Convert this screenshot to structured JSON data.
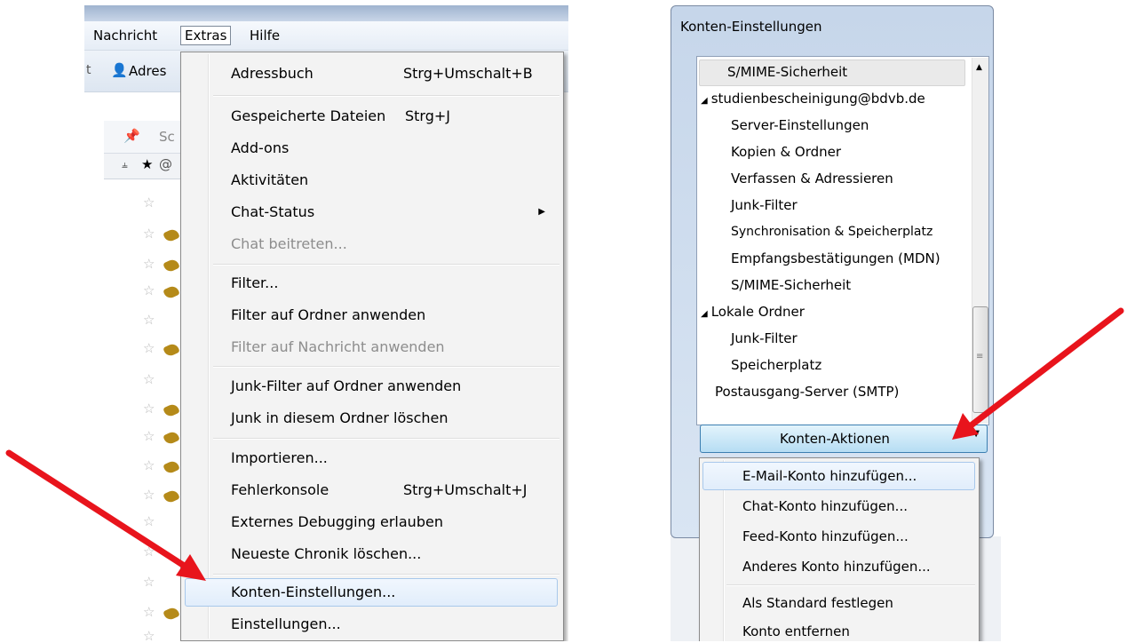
{
  "left": {
    "menubar": [
      "Nachricht",
      "Extras",
      "Hilfe"
    ],
    "toolbar_label": "Adres",
    "search_partial": "Sc",
    "menu": [
      {
        "label": "Adressbuch",
        "shortcut": "Strg+Umschalt+B"
      },
      {
        "label": "Gespeicherte Dateien",
        "shortcut": "Strg+J"
      },
      {
        "label": "Add-ons",
        "shortcut": ""
      },
      {
        "label": "Aktivitäten",
        "shortcut": ""
      },
      {
        "label": "Chat-Status",
        "shortcut": ""
      },
      {
        "label": "Chat beitreten...",
        "shortcut": ""
      },
      {
        "label": "Filter...",
        "shortcut": ""
      },
      {
        "label": "Filter auf Ordner anwenden",
        "shortcut": ""
      },
      {
        "label": "Filter auf Nachricht anwenden",
        "shortcut": ""
      },
      {
        "label": "Junk-Filter auf Ordner anwenden",
        "shortcut": ""
      },
      {
        "label": "Junk in diesem Ordner löschen",
        "shortcut": ""
      },
      {
        "label": "Importieren...",
        "shortcut": ""
      },
      {
        "label": "Fehlerkonsole",
        "shortcut": "Strg+Umschalt+J"
      },
      {
        "label": "Externes Debugging erlauben",
        "shortcut": ""
      },
      {
        "label": "Neueste Chronik löschen...",
        "shortcut": ""
      },
      {
        "label": "Konten-Einstellungen...",
        "shortcut": ""
      },
      {
        "label": "Einstellungen...",
        "shortcut": ""
      }
    ]
  },
  "right": {
    "dialog_title": "Konten-Einstellungen",
    "tree": [
      "S/MIME-Sicherheit",
      "studienbescheinigung@bdvb.de",
      "Server-Einstellungen",
      "Kopien & Ordner",
      "Verfassen & Adressieren",
      "Junk-Filter",
      "Synchronisation & Speicherplatz",
      "Empfangsbestätigungen (MDN)",
      "S/MIME-Sicherheit",
      "Lokale Ordner",
      "Junk-Filter",
      "Speicherplatz",
      "Postausgang-Server (SMTP)"
    ],
    "actions_button": "Konten-Aktionen",
    "actions_menu": [
      "E-Mail-Konto hinzufügen...",
      "Chat-Konto hinzufügen...",
      "Feed-Konto hinzufügen...",
      "Anderes Konto hinzufügen...",
      "Als Standard festlegen",
      "Konto entfernen"
    ]
  },
  "colors": {
    "arrow": "#e8141c",
    "highlight_border": "#a8c8eb",
    "button_border": "#3c7fb1"
  }
}
